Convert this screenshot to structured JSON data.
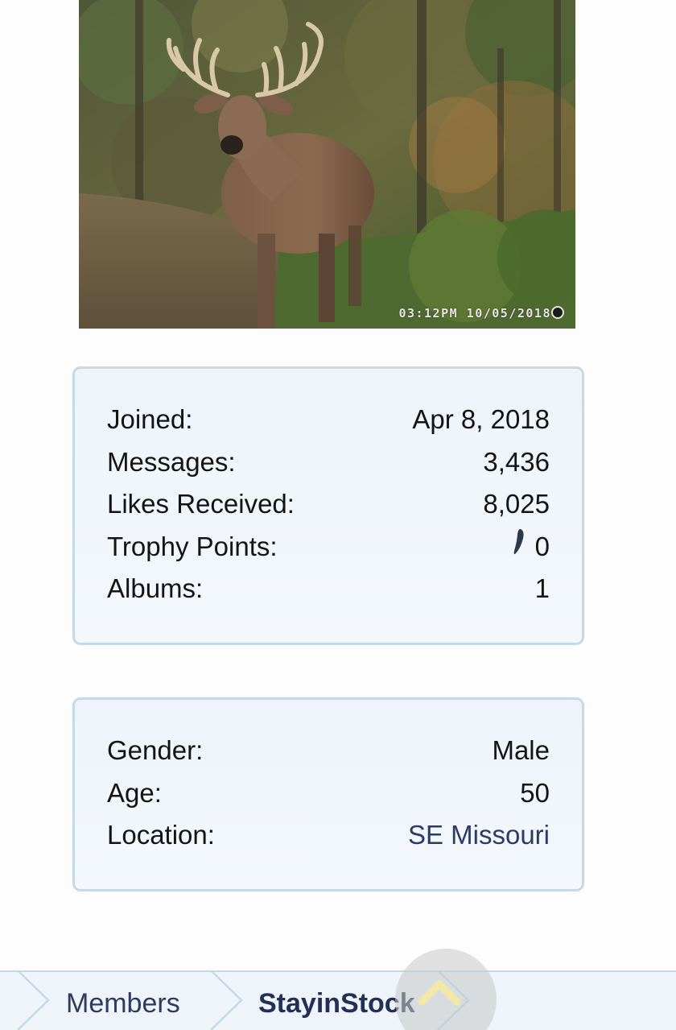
{
  "avatar": {
    "alt": "Trail camera photo of a whitetail buck",
    "timestamp": "03:12PM 10/05/2018"
  },
  "stats": {
    "joined_label": "Joined:",
    "joined_value": "Apr 8, 2018",
    "messages_label": "Messages:",
    "messages_value": "3,436",
    "likes_label": "Likes Received:",
    "likes_value": "8,025",
    "trophy_label": "Trophy Points:",
    "trophy_value": "0",
    "albums_label": "Albums:",
    "albums_value": "1"
  },
  "about": {
    "gender_label": "Gender:",
    "gender_value": "Male",
    "age_label": "Age:",
    "age_value": "50",
    "location_label": "Location:",
    "location_value": "SE Missouri"
  },
  "breadcrumb": {
    "members": "Members",
    "current": "StayinStock"
  },
  "icons": {
    "trophy": "trophy-icon",
    "scroll_top": "chevron-up-icon"
  },
  "colors": {
    "box_border": "#c5d9e6",
    "box_bg": "#eef4fa",
    "link": "#2d3a66",
    "chevron": "#f2e9a6"
  }
}
